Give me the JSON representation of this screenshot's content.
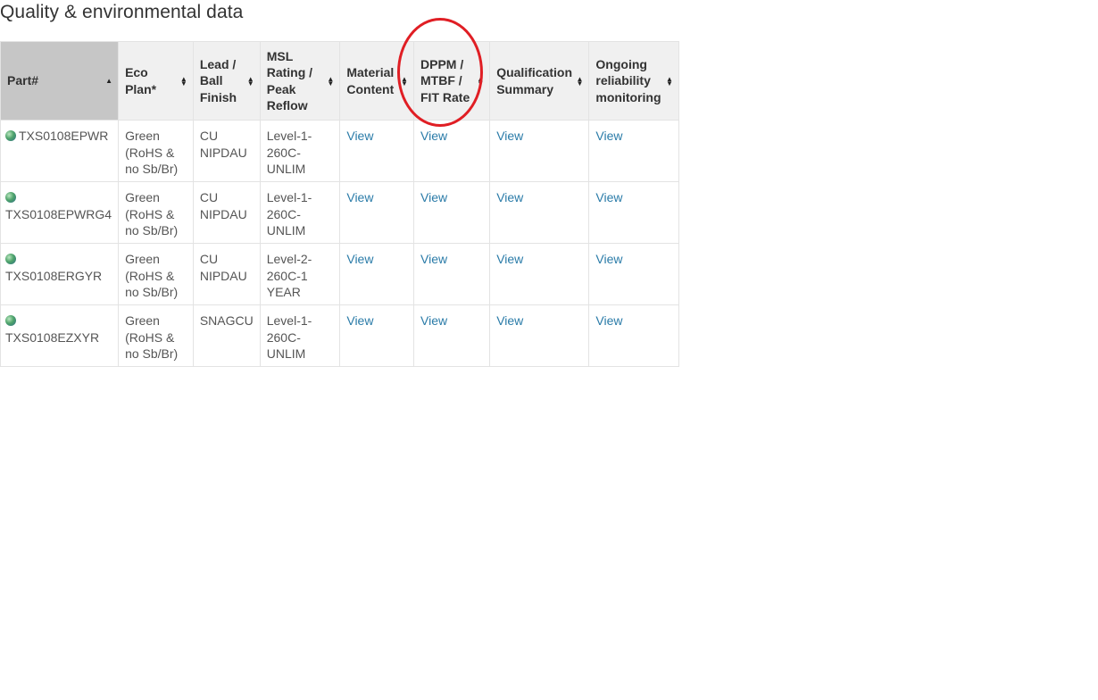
{
  "page": {
    "title": "Quality & environmental data"
  },
  "table": {
    "headers": [
      {
        "label": "Part#",
        "sort": "asc"
      },
      {
        "label": "Eco Plan*",
        "sort": "both"
      },
      {
        "label": "Lead / Ball Finish",
        "sort": "both"
      },
      {
        "label": "MSL Rating / Peak Reflow",
        "sort": "both"
      },
      {
        "label": "Material Content",
        "sort": "both"
      },
      {
        "label": "DPPM / MTBF / FIT Rate",
        "sort": "both"
      },
      {
        "label": "Qualification Summary",
        "sort": "both"
      },
      {
        "label": "Ongoing reliability monitoring",
        "sort": "both"
      }
    ],
    "rows": [
      {
        "part": "TXS0108EPWR",
        "eco_plan": "Green (RoHS & no Sb/Br)",
        "finish": "CU NIPDAU",
        "msl": "Level-1-260C-UNLIM",
        "material": "View",
        "dppm": "View",
        "qualification": "View",
        "reliability": "View"
      },
      {
        "part": "TXS0108EPWRG4",
        "eco_plan": "Green (RoHS & no Sb/Br)",
        "finish": "CU NIPDAU",
        "msl": "Level-1-260C-UNLIM",
        "material": "View",
        "dppm": "View",
        "qualification": "View",
        "reliability": "View"
      },
      {
        "part": "TXS0108ERGYR",
        "eco_plan": "Green (RoHS & no Sb/Br)",
        "finish": "CU NIPDAU",
        "msl": "Level-2-260C-1 YEAR",
        "material": "View",
        "dppm": "View",
        "qualification": "View",
        "reliability": "View"
      },
      {
        "part": "TXS0108EZXYR",
        "eco_plan": "Green (RoHS & no Sb/Br)",
        "finish": "SNAGCU",
        "msl": "Level-1-260C-UNLIM",
        "material": "View",
        "dppm": "View",
        "qualification": "View",
        "reliability": "View"
      }
    ]
  },
  "icons": {
    "part_icon": "globe-icon",
    "sort_icon": "sort-icon"
  },
  "colors": {
    "link": "#2a7ba8",
    "annotation": "#e01e24",
    "header_bg": "#f0f0f0",
    "sorted_header_bg": "#c6c6c6"
  }
}
